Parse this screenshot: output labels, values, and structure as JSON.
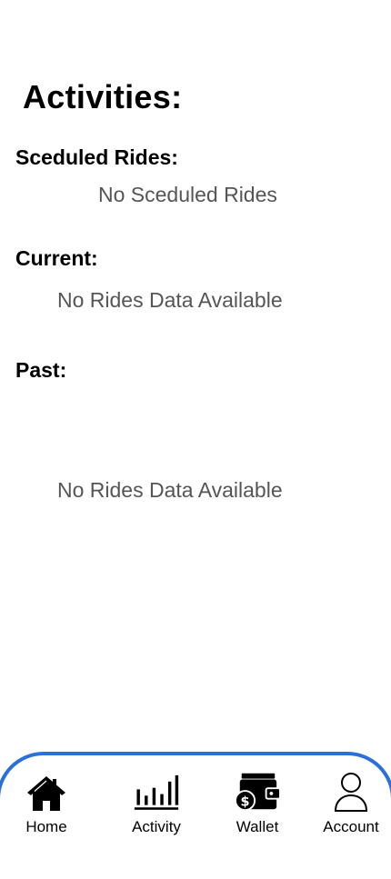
{
  "page": {
    "title": "Activities:"
  },
  "sections": {
    "scheduled": {
      "heading": "Sceduled Rides:",
      "empty_text": "No Sceduled Rides"
    },
    "current": {
      "heading": "Current:",
      "empty_text": "No Rides Data Available"
    },
    "past": {
      "heading": "Past:",
      "empty_text": "No Rides Data Available"
    }
  },
  "bottom_nav": {
    "accent_color": "#2a6fdb",
    "items": [
      {
        "label": "Home",
        "icon": "home-icon"
      },
      {
        "label": "Activity",
        "icon": "bar-chart-icon",
        "selected": true
      },
      {
        "label": "Wallet",
        "icon": "wallet-icon"
      },
      {
        "label": "Account",
        "icon": "person-icon"
      }
    ]
  }
}
